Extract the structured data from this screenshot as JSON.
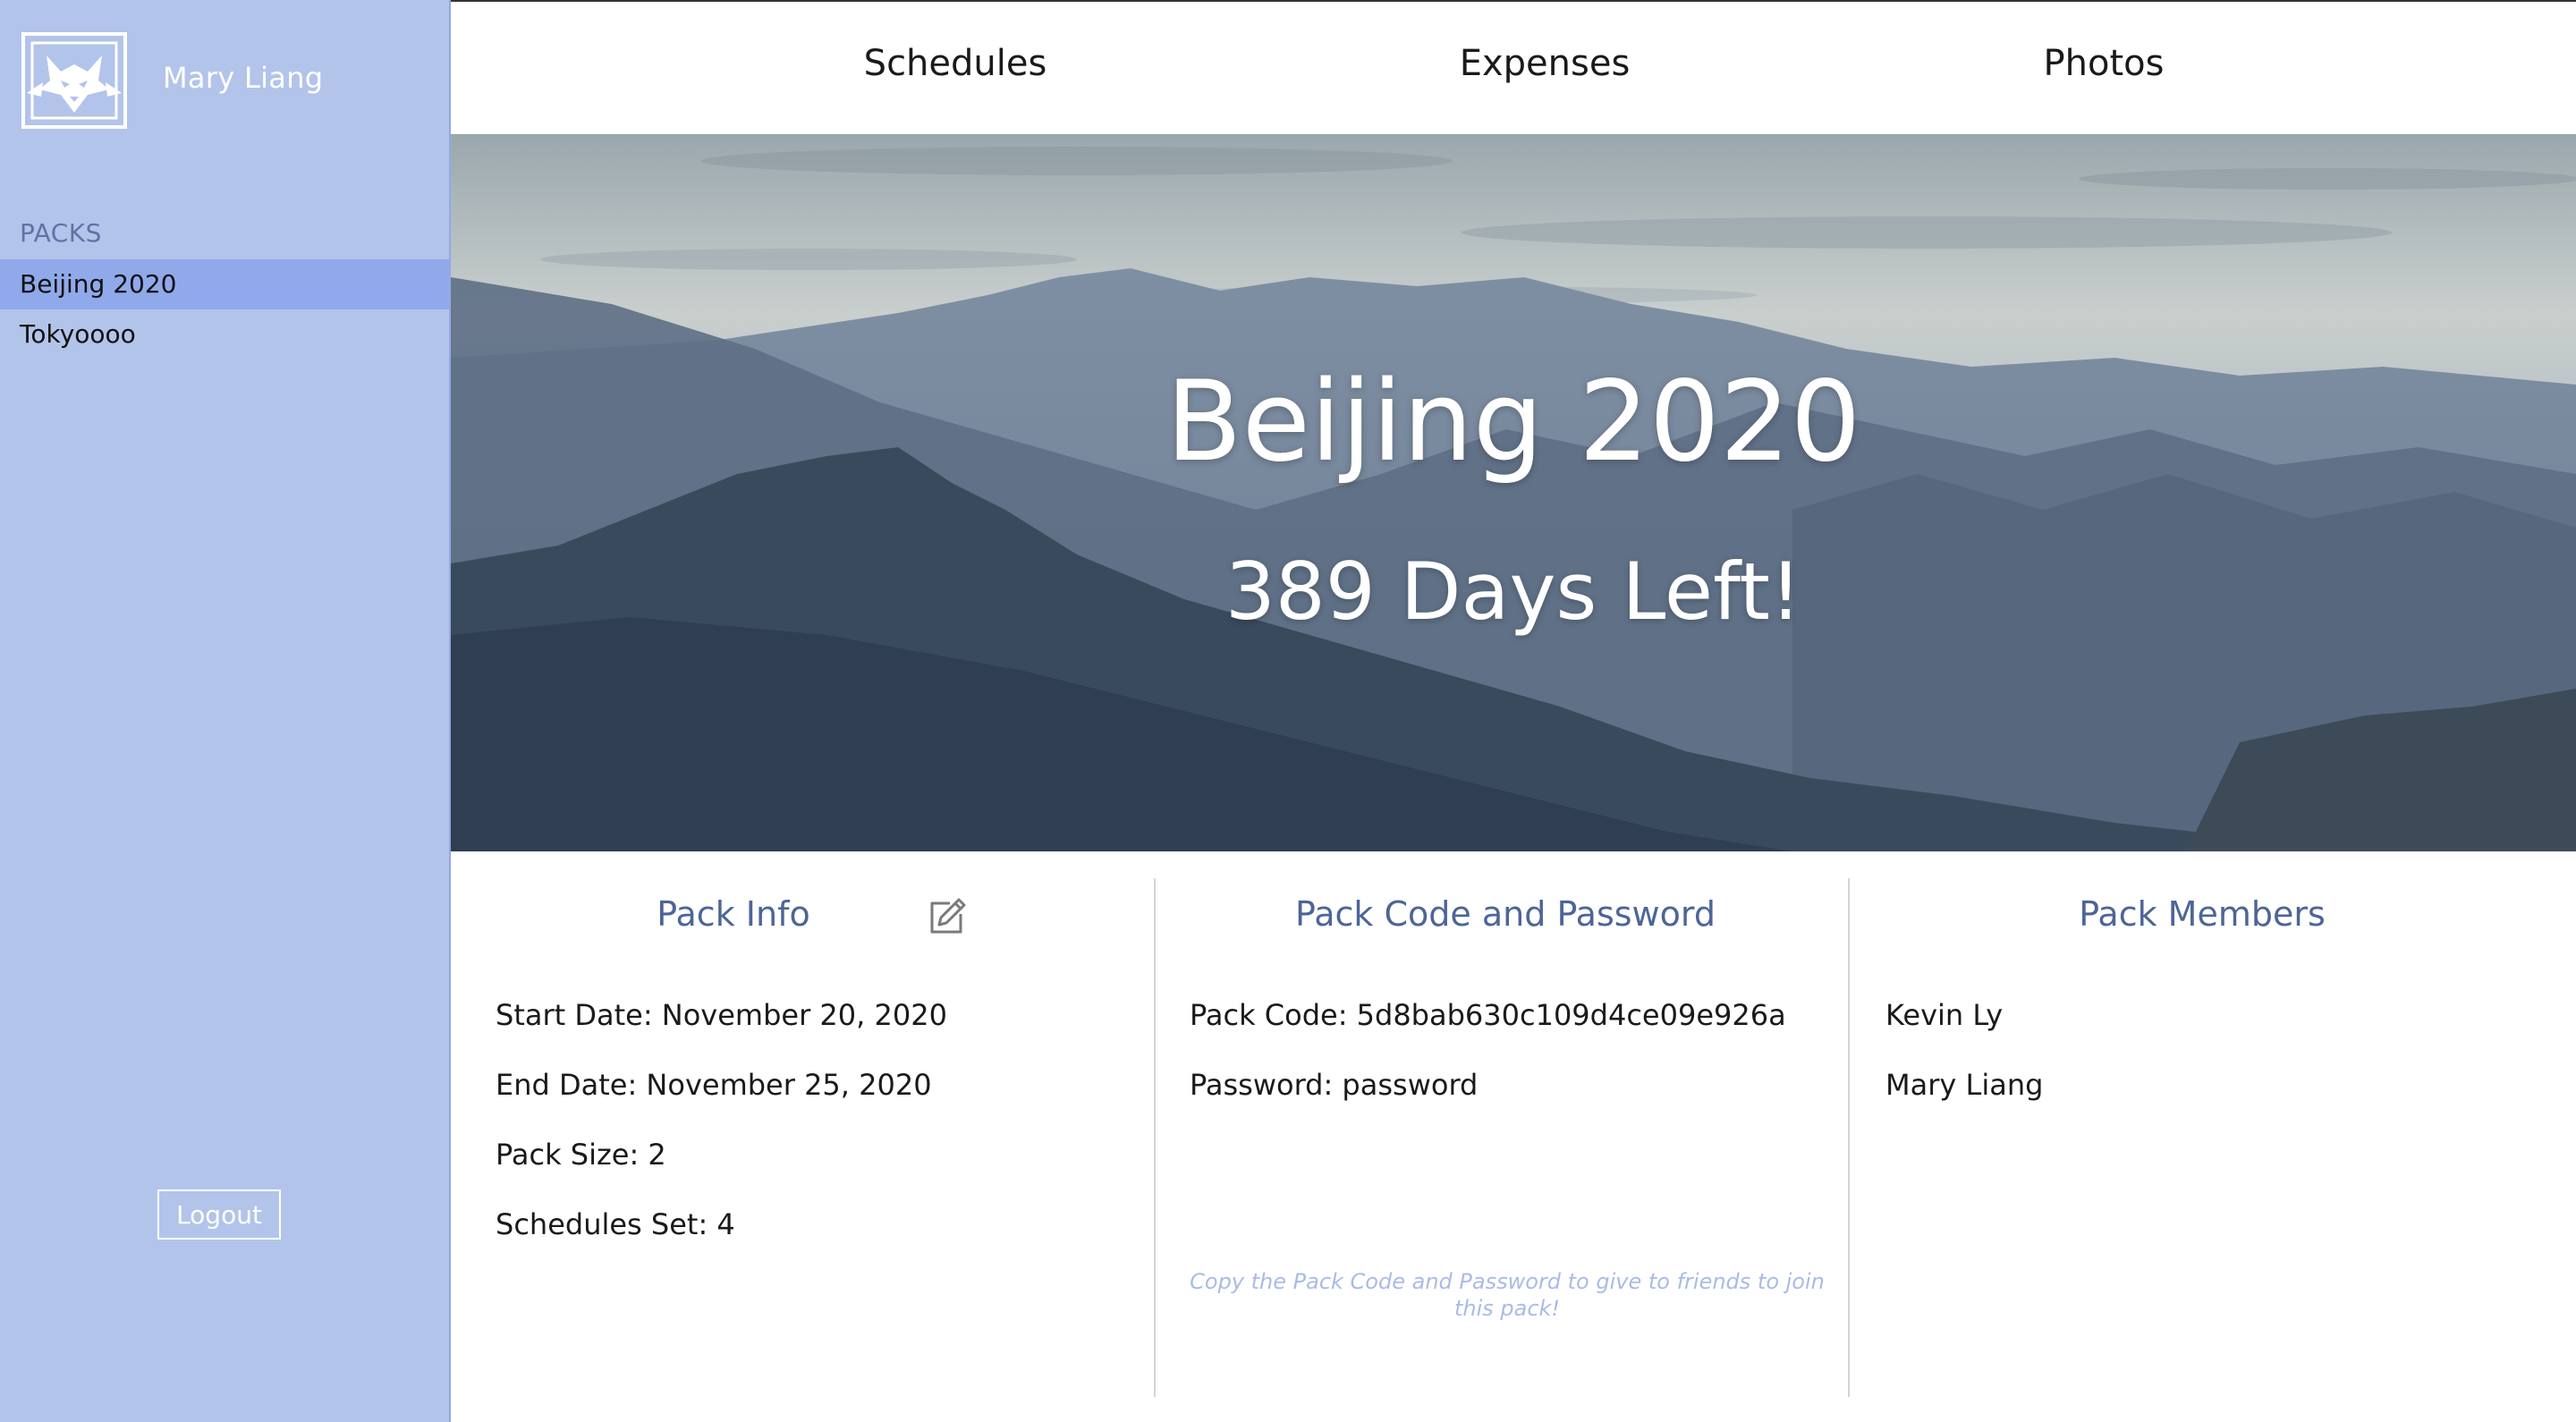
{
  "user": {
    "name": "Mary Liang"
  },
  "sidebar": {
    "section_label": "PACKS",
    "packs": [
      {
        "label": "Beijing 2020",
        "active": true
      },
      {
        "label": "Tokyoooo",
        "active": false
      }
    ],
    "logout_label": "Logout"
  },
  "nav": {
    "links": [
      "Schedules",
      "Expenses",
      "Photos"
    ]
  },
  "hero": {
    "title": "Beijing 2020",
    "subtitle": "389 Days Left!"
  },
  "pack_info": {
    "heading": "Pack Info",
    "start_date": "Start Date: November 20, 2020",
    "end_date": "End Date: November 25, 2020",
    "pack_size": "Pack Size: 2",
    "schedules_set": "Schedules Set: 4",
    "edit_icon": "edit-icon"
  },
  "pack_code": {
    "heading": "Pack Code and Password",
    "code": "Pack Code: 5d8bab630c109d4ce09e926a",
    "password": "Password: password",
    "hint": "Copy the Pack Code and Password to give to friends to join this pack!"
  },
  "pack_members": {
    "heading": "Pack Members",
    "members": [
      "Kevin Ly",
      "Mary Liang"
    ]
  },
  "colors": {
    "sidebar_bg": "#b3c4ea",
    "active_pack_bg": "#90a9ea",
    "heading_blue": "#4d6597",
    "hint_blue": "#a9bbe6"
  }
}
